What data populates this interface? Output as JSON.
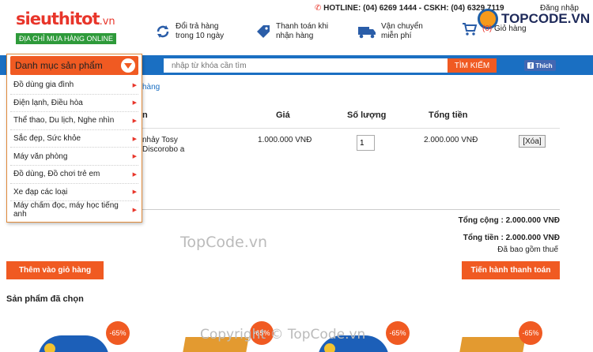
{
  "header": {
    "logo_main": "sieuthitot",
    "logo_domain": ".vn",
    "logo_tagline": "ĐỊA CHỈ MUA HÀNG ONLINE",
    "hotline": "HOTLINE: (04) 6269 1444 - CSKH: (04) 6329 7119",
    "login": "Đăng nhập",
    "watermark": "TOPCODE.VN",
    "features": [
      {
        "line1": "Đổi trả hàng",
        "line2": "trong 10 ngày",
        "icon": "refresh-icon"
      },
      {
        "line1": "Thanh toán khi",
        "line2": "nhận hàng",
        "icon": "price-tag-icon"
      },
      {
        "line1": "Vận chuyển",
        "line2": "miễn phí",
        "icon": "truck-icon"
      }
    ],
    "cart": {
      "count": "(0)",
      "label": "Giỏ hàng",
      "icon": "cart-icon"
    }
  },
  "search": {
    "placeholder": "nhập từ khóa cần tìm",
    "button": "TÌM KIẾM",
    "like": "Thích"
  },
  "categories": {
    "title": "Danh mục sản phẩm",
    "items": [
      "Đồ dùng gia đình",
      "Điện lạnh, Điều hòa",
      "Thể thao, Du lịch, Nghe nhìn",
      "Sắc đẹp, Sức khỏe",
      "Máy văn phòng",
      "Đồ dùng, Đồ chơi trẻ em",
      "Xe đạp các loại",
      "Máy chấm đọc, máy học tiếng anh"
    ]
  },
  "breadcrumb_tail": "hàng",
  "cart_table": {
    "headers": {
      "name": "n",
      "price": "Giá",
      "qty": "Số lượng",
      "total": "Tổng tiền"
    },
    "rows": [
      {
        "name": "nhảy Tosy Discorobo a",
        "price": "1.000.000 VNĐ",
        "qty": "1",
        "total": "2.000.000 VNĐ",
        "delete": "[Xóa]"
      }
    ]
  },
  "summary": {
    "subtotal": "Tổng cộng : 2.000.000 VNĐ",
    "total": "Tổng tiền : 2.000.000 VNĐ",
    "tax_note": "Đã bao gồm thuế"
  },
  "actions": {
    "add_to_cart": "Thêm vào giỏ hàng",
    "checkout": "Tiến hành thanh toán"
  },
  "watermark_mid": "TopCode.vn",
  "watermark_bottom": "Copyright © TopCode.vn",
  "chosen": {
    "title": "Sản phẩm đã chọn",
    "products": [
      {
        "discount": "-65%",
        "type": "toy"
      },
      {
        "discount": "-65%",
        "type": "box"
      },
      {
        "discount": "-65%",
        "type": "toy"
      },
      {
        "discount": "-65%",
        "type": "box"
      }
    ]
  },
  "colors": {
    "accent": "#f05a22",
    "blue_bar": "#1a6fc2",
    "logo_red": "#e8352a",
    "logo_green": "#2e9a3a"
  }
}
